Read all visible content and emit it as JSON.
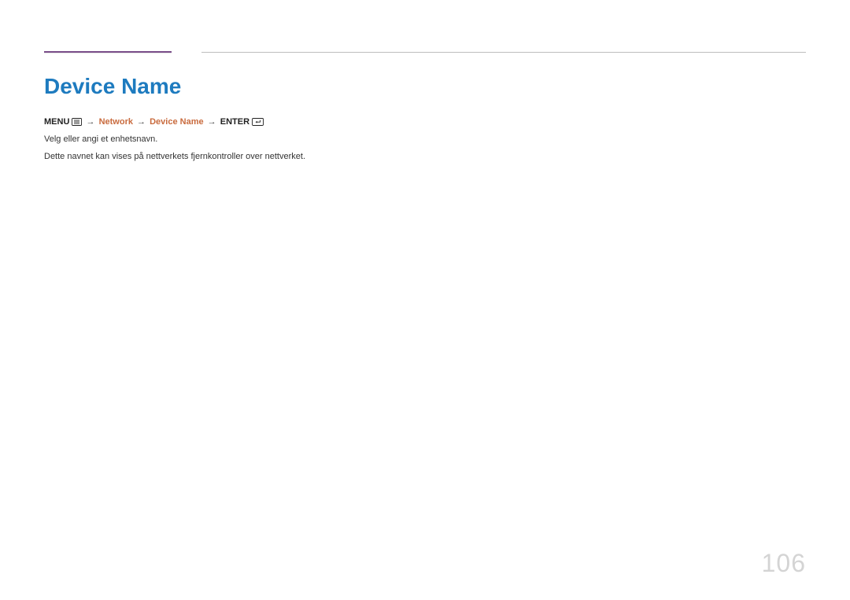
{
  "heading": "Device Name",
  "nav": {
    "menu_label": "MENU",
    "arrow": "→",
    "network": "Network",
    "device_name": "Device Name",
    "enter_label": "ENTER"
  },
  "paragraphs": {
    "p1": "Velg eller angi et enhetsnavn.",
    "p2": "Dette navnet kan vises på nettverkets fjernkontroller over nettverket."
  },
  "page_number": "106"
}
